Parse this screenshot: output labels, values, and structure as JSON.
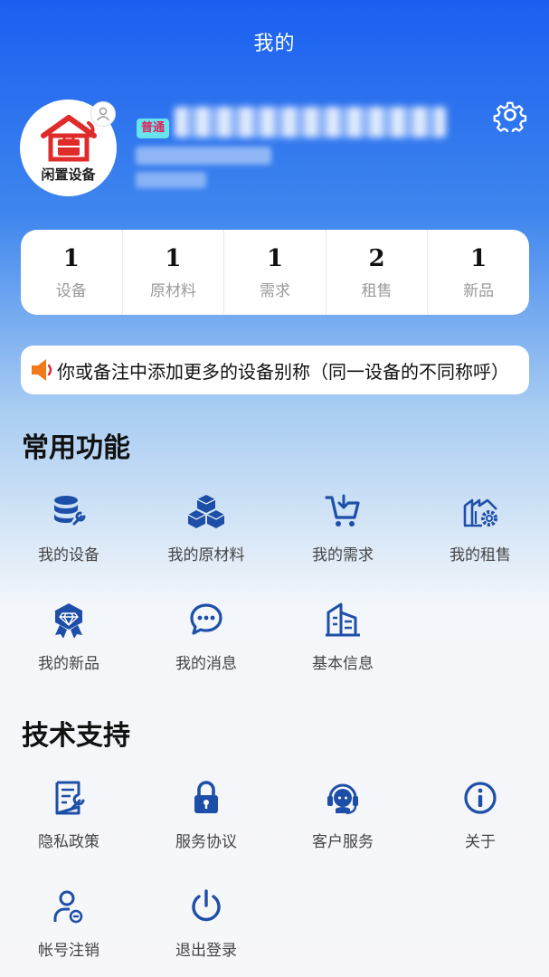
{
  "header": {
    "title": "我的"
  },
  "profile": {
    "logo_text": "闲置设备",
    "level_badge": "普通"
  },
  "stats": [
    {
      "value": "1",
      "label": "设备"
    },
    {
      "value": "1",
      "label": "原材料"
    },
    {
      "value": "1",
      "label": "需求"
    },
    {
      "value": "2",
      "label": "租售"
    },
    {
      "value": "1",
      "label": "新品"
    }
  ],
  "notice": {
    "text": "你或备注中添加更多的设备别称（同一设备的不同称呼）"
  },
  "common": {
    "title": "常用功能",
    "items": [
      {
        "label": "我的设备",
        "icon": "database-wrench-icon"
      },
      {
        "label": "我的原材料",
        "icon": "boxes-icon"
      },
      {
        "label": "我的需求",
        "icon": "cart-icon"
      },
      {
        "label": "我的租售",
        "icon": "factory-gear-icon"
      },
      {
        "label": "我的新品",
        "icon": "diamond-badge-icon"
      },
      {
        "label": "我的消息",
        "icon": "chat-bubble-icon"
      },
      {
        "label": "基本信息",
        "icon": "building-icon"
      }
    ]
  },
  "support": {
    "title": "技术支持",
    "items": [
      {
        "label": "隐私政策",
        "icon": "document-wrench-icon"
      },
      {
        "label": "服务协议",
        "icon": "lock-icon"
      },
      {
        "label": "客户服务",
        "icon": "headset-icon"
      },
      {
        "label": "关于",
        "icon": "info-icon"
      },
      {
        "label": "帐号注销",
        "icon": "user-minus-icon"
      },
      {
        "label": "退出登录",
        "icon": "power-icon"
      }
    ]
  },
  "colors": {
    "accent": "#1e4fa8",
    "header_blue": "#1a5ff0",
    "brand_red": "#e02b2b"
  }
}
